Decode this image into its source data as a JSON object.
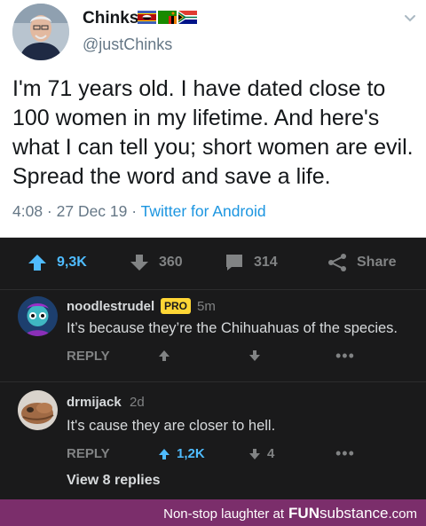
{
  "tweet": {
    "name": "Chinks",
    "flags": [
      "eswatini-flag",
      "zambia-flag",
      "south-africa-flag"
    ],
    "handle": "@justChinks",
    "text": "I'm 71 years old. I have dated close to 100 women in my lifetime. And here's what I can tell you; short women are evil. Spread the word and save a life.",
    "time": "4:08 · 27 Dec 19 · ",
    "source": "Twitter for Android"
  },
  "post_bar": {
    "upvotes": "9,3K",
    "downvotes": "360",
    "comments": "314",
    "share": "Share"
  },
  "comments": [
    {
      "user": "noodlestrudel",
      "badge": "PRO",
      "time": "5m",
      "body": "It’s because they’re the Chihuahuas of the species.",
      "reply": "REPLY"
    },
    {
      "user": "drmijack",
      "time": "2d",
      "body": "It's cause they are closer to hell.",
      "reply": "REPLY",
      "upvotes": "1,2K",
      "downvotes": "4",
      "view_replies": "View 8 replies"
    }
  ],
  "footer": {
    "tagline": "Non-stop laughter at",
    "brand_bold": "FUN",
    "brand_rest": "substance",
    "domain": ".com"
  },
  "colors": {
    "tweet_link": "#1b95e0",
    "reddit_bg": "#1a1a1b",
    "upvote_blue": "#4fbcff",
    "pro_badge": "#ffd635",
    "footer_purple": "#7b2e6b"
  }
}
